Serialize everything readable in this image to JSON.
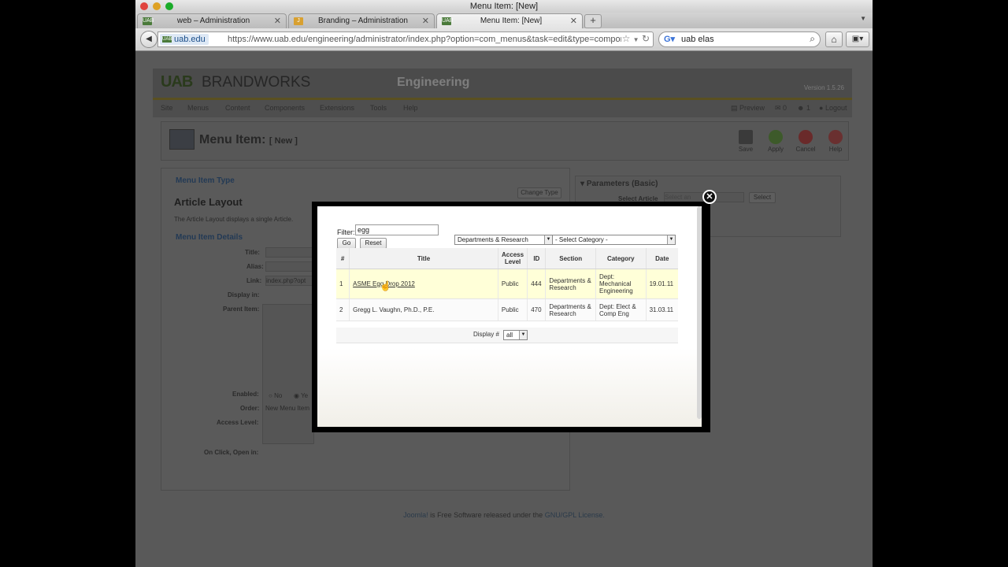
{
  "window": {
    "title": "Menu Item: [New]"
  },
  "tabs": [
    {
      "label": "web – Administration",
      "active": false,
      "icon": "uab-favicon"
    },
    {
      "label": "Branding – Administration",
      "active": false,
      "icon": "joomla-favicon"
    },
    {
      "label": "Menu Item: [New]",
      "active": true,
      "icon": "uab-favicon"
    }
  ],
  "nav": {
    "site_identity": "uab.edu",
    "url": "https://www.uab.edu/engineering/administrator/index.php?option=com_menus&task=edit&type=component&url[op",
    "search_value": "uab elas"
  },
  "page": {
    "brand_logo": "UAB",
    "brand_name": "BRANDWORKS",
    "site_name": "Engineering",
    "version": "Version 1.5.26",
    "menu": [
      "Site",
      "Menus",
      "Content",
      "Components",
      "Extensions",
      "Tools",
      "Help"
    ],
    "status": {
      "preview": "Preview",
      "messages": "0",
      "users": "1",
      "logout": "Logout"
    },
    "heading": "Menu Item:",
    "heading_sub": "[ New ]",
    "toolbar": {
      "save": "Save",
      "apply": "Apply",
      "cancel": "Cancel",
      "help": "Help"
    },
    "menu_item_type_label": "Menu Item Type",
    "change_type": "Change Type",
    "layout_title": "Article Layout",
    "layout_desc": "The Article Layout displays a single Article.",
    "details_label": "Menu Item Details",
    "fields": {
      "title": "Title:",
      "alias": "Alias:",
      "link": "Link:",
      "link_value": "index.php?opt",
      "display_in": "Display in:",
      "parent_item": "Parent Item:",
      "enabled": "Enabled:",
      "enabled_no": "No",
      "enabled_yes": "Ye",
      "order": "Order:",
      "order_value": "New Menu Item",
      "access_level": "Access Level:",
      "on_click": "On Click, Open in:"
    },
    "params_label": "Parameters (Basic)",
    "select_article_label": "Select Article",
    "select_article_placeholder": "Select an",
    "select_btn": "Select",
    "footer_link1": "Joomla!",
    "footer_text": " is Free Software released under the ",
    "footer_link2": "GNU/GPL License."
  },
  "modal": {
    "filter_label": "Filter:",
    "filter_value": "egg",
    "go": "Go",
    "reset": "Reset",
    "section_select": "Departments & Research",
    "category_select": "- Select Category -",
    "columns": [
      "#",
      "Title",
      "Access Level",
      "ID",
      "Section",
      "Category",
      "Date"
    ],
    "rows": [
      {
        "num": "1",
        "title": "ASME Egg Drop 2012",
        "access": "Public",
        "id": "444",
        "section": "Departments & Research",
        "category": "Dept: Mechanical Engineering",
        "date": "19.01.11"
      },
      {
        "num": "2",
        "title": "Gregg L. Vaughn, Ph.D., P.E.",
        "access": "Public",
        "id": "470",
        "section": "Departments & Research",
        "category": "Dept: Elect & Comp Eng",
        "date": "31.03.11"
      }
    ],
    "display_label": "Display #",
    "display_value": "all"
  }
}
